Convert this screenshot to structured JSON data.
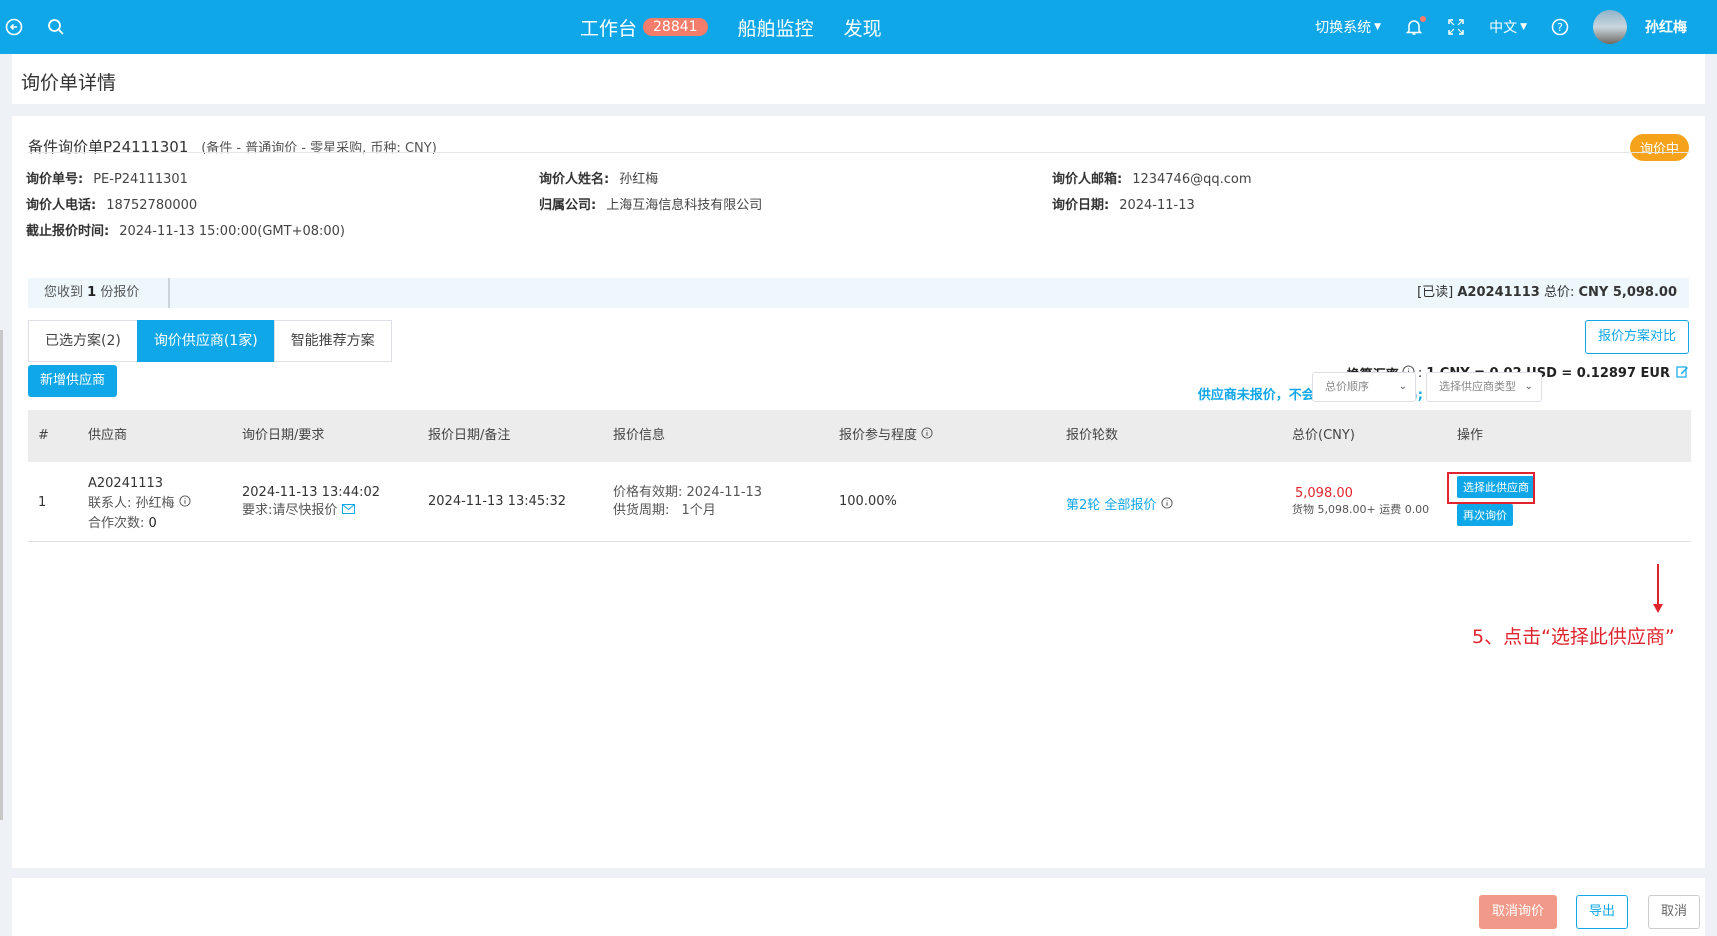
{
  "topbar": {
    "workbench_label": "工作台",
    "workbench_badge": "28841",
    "ship_monitor_label": "船舶监控",
    "discover_label": "发现",
    "switch_system_label": "切换系统",
    "language_label": "中文",
    "username": "孙红梅"
  },
  "page": {
    "title": "询价单详情"
  },
  "order": {
    "title": "备件询价单P24111301",
    "subtitle": "(备件 - 普通询价 - 零星采购, 币种: CNY)",
    "status": "询价中",
    "fields": {
      "inquiry_no_label": "询价单号:",
      "inquiry_no": "PE-P24111301",
      "inquirer_name_label": "询价人姓名:",
      "inquirer_name": "孙红梅",
      "inquirer_email_label": "询价人邮箱:",
      "inquirer_email": "1234746@qq.com",
      "inquirer_phone_label": "询价人电话:",
      "inquirer_phone": "18752780000",
      "company_label": "归属公司:",
      "company": "上海互海信息科技有限公司",
      "inquiry_date_label": "询价日期:",
      "inquiry_date": "2024-11-13",
      "deadline_label": "截止报价时间:",
      "deadline": "2024-11-13 15:00:00(GMT+08:00)"
    }
  },
  "receipt": {
    "prefix": "您收到",
    "count": "1",
    "suffix": "份报价",
    "right_read": "[已读]",
    "right_supplier": "A20241113",
    "right_total_label": "总价:",
    "right_total": "CNY 5,098.00"
  },
  "tabs": [
    {
      "label": "已选方案(2)"
    },
    {
      "label": "询价供应商(1家)"
    },
    {
      "label": "智能推荐方案"
    }
  ],
  "compare_button": "报价方案对比",
  "exchange": {
    "label": "换算汇率",
    "value": "1 CNY = 0.02 USD = 0.12897 EUR"
  },
  "add_supplier_button": "新增供应商",
  "help_link": "供应商未报价，不会操作? 请联系小易;",
  "filters": {
    "sort_placeholder": "总价顺序",
    "type_placeholder": "选择供应商类型"
  },
  "table": {
    "headers": [
      "#",
      "供应商",
      "询价日期/要求",
      "报价日期/备注",
      "报价信息",
      "报价参与程度",
      "报价轮数",
      "总价(CNY)",
      "操作"
    ],
    "rows": [
      {
        "index": "1",
        "supplier_code": "A20241113",
        "contact_label": "联系人:",
        "contact_name": "孙红梅",
        "coop_label": "合作次数:",
        "coop_count": "0",
        "inquiry_date": "2024-11-13 13:44:02",
        "requirement": "要求:请尽快报价",
        "quote_date": "2024-11-13 13:45:32",
        "validity": "价格有效期: 2024-11-13",
        "supply_period_label": "供货周期:",
        "supply_period": "1个月",
        "participation": "100.00%",
        "rounds": "第2轮 全部报价",
        "total": "5,098.00",
        "breakdown": "货物 5,098.00+ 运费 0.00",
        "select_button": "选择此供应商",
        "reinquire_button": "再次询价"
      }
    ]
  },
  "annotation": "5、点击“选择此供应商”",
  "footer": {
    "cancel_inquiry": "取消询价",
    "export": "导出",
    "cancel": "取消"
  },
  "colors": {
    "primary": "#10a7e8",
    "status_orange": "#f7a21b",
    "danger": "#e0242d"
  }
}
